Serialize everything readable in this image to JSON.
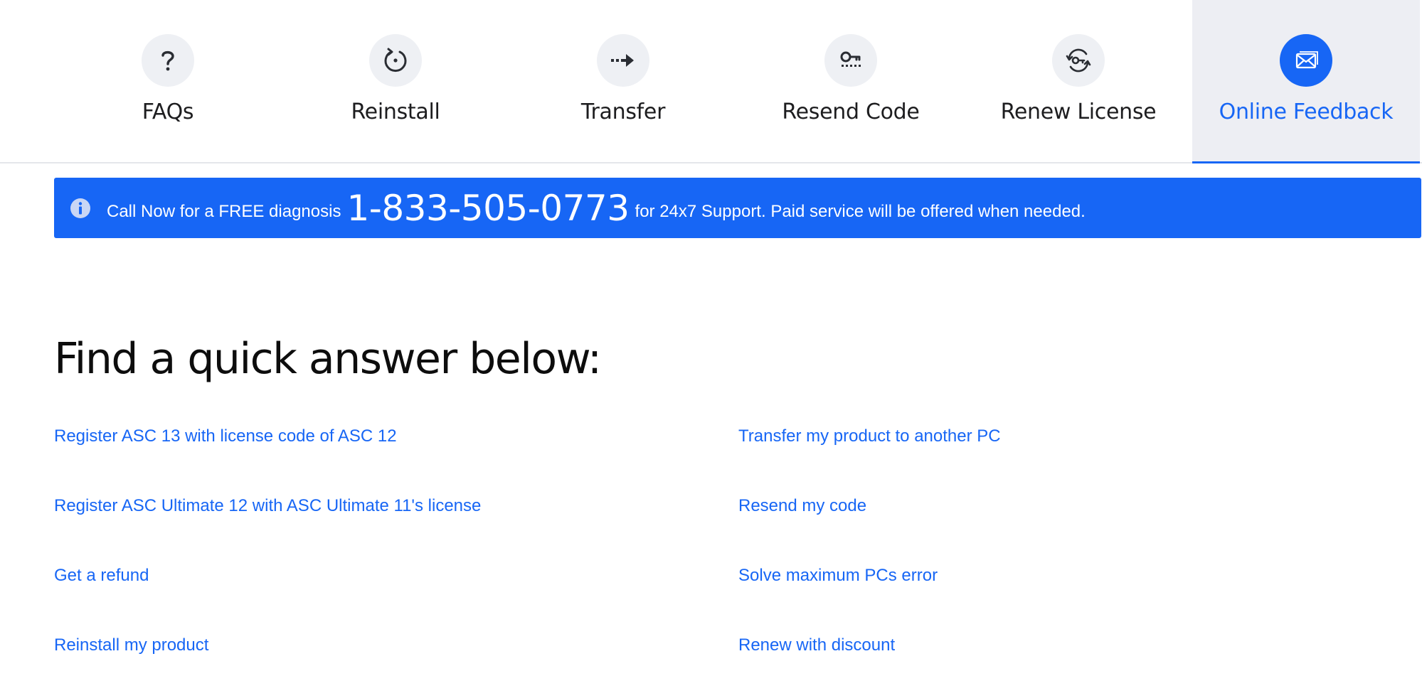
{
  "tabs": [
    {
      "label": "FAQs",
      "icon": "question-mark-icon",
      "active": false
    },
    {
      "label": "Reinstall",
      "icon": "reinstall-icon",
      "active": false
    },
    {
      "label": "Transfer",
      "icon": "transfer-arrow-icon",
      "active": false
    },
    {
      "label": "Resend Code",
      "icon": "key-icon",
      "active": false
    },
    {
      "label": "Renew License",
      "icon": "renew-key-icon",
      "active": false
    },
    {
      "label": "Online Feedback",
      "icon": "envelope-icon",
      "active": true
    }
  ],
  "banner": {
    "icon": "info-icon",
    "pre_text": "Call Now for a FREE diagnosis",
    "phone": "1-833-505-0773",
    "post_text": "for 24x7 Support. Paid service will be offered when needed."
  },
  "quick_answers": {
    "heading": "Find a quick answer below:",
    "left_links": [
      "Register ASC 13 with license code of ASC 12",
      "Register ASC Ultimate 12 with ASC Ultimate 11's license",
      "Get a refund",
      "Reinstall my product"
    ],
    "right_links": [
      "Transfer my product to another PC",
      "Resend my code",
      "Solve maximum PCs error",
      "Renew with discount"
    ]
  },
  "colors": {
    "accent": "#1766f5",
    "tab_active_bg": "#edeef3",
    "icon_circle_bg": "#eef0f4",
    "text_dark": "#1d1d1f"
  }
}
